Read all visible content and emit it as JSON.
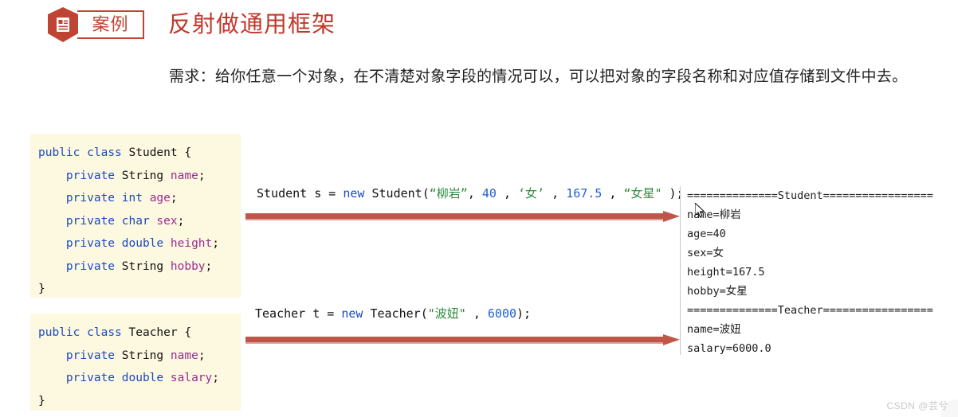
{
  "header": {
    "badge_icon": "document-list-icon",
    "badge_label": "案例",
    "title": "反射做通用框架",
    "accent_color": "#c0392b",
    "badge_color": "#bf4433"
  },
  "requirement": {
    "text": "需求：给你任意一个对象，在不清楚对象字段的情况可以，可以把对象的字段名称和对应值存储到文件中去。"
  },
  "code_student": {
    "lines": [
      {
        "parts": [
          {
            "t": "public",
            "c": "kw"
          },
          {
            "t": " ",
            "c": "pn"
          },
          {
            "t": "class",
            "c": "kw"
          },
          {
            "t": " ",
            "c": "pn"
          },
          {
            "t": "Student",
            "c": "typ"
          },
          {
            "t": " {",
            "c": "pn"
          }
        ]
      },
      {
        "parts": [
          {
            "t": "    ",
            "c": "pn"
          },
          {
            "t": "private",
            "c": "kw"
          },
          {
            "t": " ",
            "c": "pn"
          },
          {
            "t": "String",
            "c": "typ"
          },
          {
            "t": " ",
            "c": "pn"
          },
          {
            "t": "name",
            "c": "fld"
          },
          {
            "t": ";",
            "c": "pn"
          }
        ]
      },
      {
        "parts": [
          {
            "t": "    ",
            "c": "pn"
          },
          {
            "t": "private",
            "c": "kw"
          },
          {
            "t": " ",
            "c": "pn"
          },
          {
            "t": "int",
            "c": "pkw"
          },
          {
            "t": " ",
            "c": "pn"
          },
          {
            "t": "age",
            "c": "fld"
          },
          {
            "t": ";",
            "c": "pn"
          }
        ]
      },
      {
        "parts": [
          {
            "t": "    ",
            "c": "pn"
          },
          {
            "t": "private",
            "c": "kw"
          },
          {
            "t": " ",
            "c": "pn"
          },
          {
            "t": "char",
            "c": "pkw"
          },
          {
            "t": " ",
            "c": "pn"
          },
          {
            "t": "sex",
            "c": "fld"
          },
          {
            "t": ";",
            "c": "pn"
          }
        ]
      },
      {
        "parts": [
          {
            "t": "    ",
            "c": "pn"
          },
          {
            "t": "private",
            "c": "kw"
          },
          {
            "t": " ",
            "c": "pn"
          },
          {
            "t": "double",
            "c": "pkw"
          },
          {
            "t": " ",
            "c": "pn"
          },
          {
            "t": "height",
            "c": "fld"
          },
          {
            "t": ";",
            "c": "pn"
          }
        ]
      },
      {
        "parts": [
          {
            "t": "    ",
            "c": "pn"
          },
          {
            "t": "private",
            "c": "kw"
          },
          {
            "t": " ",
            "c": "pn"
          },
          {
            "t": "String",
            "c": "typ"
          },
          {
            "t": " ",
            "c": "pn"
          },
          {
            "t": "hobby",
            "c": "fld"
          },
          {
            "t": ";",
            "c": "pn"
          }
        ]
      },
      {
        "parts": [
          {
            "t": "}",
            "c": "pn"
          }
        ]
      }
    ]
  },
  "code_teacher": {
    "lines": [
      {
        "parts": [
          {
            "t": "public",
            "c": "kw"
          },
          {
            "t": " ",
            "c": "pn"
          },
          {
            "t": "class",
            "c": "kw"
          },
          {
            "t": " ",
            "c": "pn"
          },
          {
            "t": "Teacher",
            "c": "typ"
          },
          {
            "t": " {",
            "c": "pn"
          }
        ]
      },
      {
        "parts": [
          {
            "t": "    ",
            "c": "pn"
          },
          {
            "t": "private",
            "c": "kw"
          },
          {
            "t": " ",
            "c": "pn"
          },
          {
            "t": "String",
            "c": "typ"
          },
          {
            "t": " ",
            "c": "pn"
          },
          {
            "t": "name",
            "c": "fld"
          },
          {
            "t": ";",
            "c": "pn"
          }
        ]
      },
      {
        "parts": [
          {
            "t": "    ",
            "c": "pn"
          },
          {
            "t": "private",
            "c": "kw"
          },
          {
            "t": " ",
            "c": "pn"
          },
          {
            "t": "double",
            "c": "pkw"
          },
          {
            "t": " ",
            "c": "pn"
          },
          {
            "t": "salary",
            "c": "fld"
          },
          {
            "t": ";",
            "c": "pn"
          }
        ]
      },
      {
        "parts": [
          {
            "t": "}",
            "c": "pn"
          }
        ]
      }
    ]
  },
  "usage_student": {
    "parts": [
      {
        "t": "Student s = ",
        "c": "pn"
      },
      {
        "t": "new",
        "c": "kw"
      },
      {
        "t": " Student(",
        "c": "pn"
      },
      {
        "t": "“柳岩”",
        "c": "str"
      },
      {
        "t": ", ",
        "c": "pn"
      },
      {
        "t": "40",
        "c": "num"
      },
      {
        "t": " , ",
        "c": "pn"
      },
      {
        "t": "‘女’",
        "c": "str"
      },
      {
        "t": " , ",
        "c": "pn"
      },
      {
        "t": "167.5",
        "c": "num"
      },
      {
        "t": " , ",
        "c": "pn"
      },
      {
        "t": "“女星\"",
        "c": "str"
      },
      {
        "t": " );",
        "c": "pn"
      }
    ]
  },
  "usage_teacher": {
    "parts": [
      {
        "t": "Teacher t = ",
        "c": "pn"
      },
      {
        "t": "new",
        "c": "kw"
      },
      {
        "t": " Teacher(",
        "c": "pn"
      },
      {
        "t": "\"波妞\"",
        "c": "str"
      },
      {
        "t": " , ",
        "c": "pn"
      },
      {
        "t": "6000",
        "c": "num"
      },
      {
        "t": ");",
        "c": "pn"
      }
    ]
  },
  "arrows": {
    "color": "#c0564a",
    "top_label": "arrow-student-to-output",
    "bottom_label": "arrow-teacher-to-output"
  },
  "console": {
    "lines": [
      "==============Student=================",
      "name=柳岩",
      "age=40",
      "sex=女",
      "height=167.5",
      "hobby=女星",
      "==============Teacher=================",
      "name=波妞",
      "salary=6000.0"
    ]
  },
  "watermark": {
    "text": "CSDN @芸兮"
  }
}
